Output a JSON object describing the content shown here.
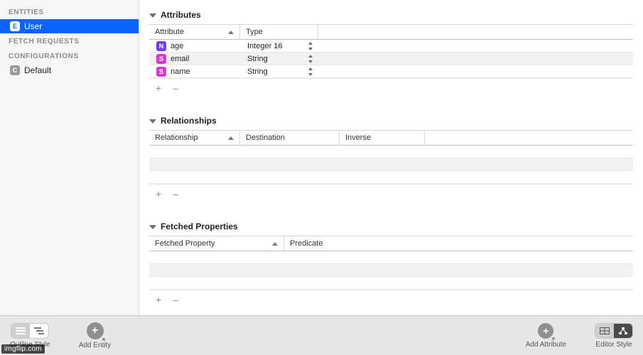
{
  "sidebar": {
    "sections": [
      {
        "title": "ENTITIES",
        "items": [
          {
            "badge": "E",
            "label": "User",
            "selected": true
          }
        ]
      },
      {
        "title": "FETCH REQUESTS",
        "items": []
      },
      {
        "title": "CONFIGURATIONS",
        "items": [
          {
            "badge": "C",
            "label": "Default",
            "selected": false
          }
        ]
      }
    ]
  },
  "attributes": {
    "title": "Attributes",
    "columns": {
      "attribute": "Attribute",
      "type": "Type"
    },
    "rows": [
      {
        "badge": "N",
        "name": "age",
        "type": "Integer 16"
      },
      {
        "badge": "S",
        "name": "email",
        "type": "String"
      },
      {
        "badge": "S",
        "name": "name",
        "type": "String"
      }
    ],
    "add_glyph": "+",
    "remove_glyph": "–"
  },
  "relationships": {
    "title": "Relationships",
    "columns": {
      "relationship": "Relationship",
      "destination": "Destination",
      "inverse": "Inverse"
    },
    "rows": [],
    "add_glyph": "+",
    "remove_glyph": "–"
  },
  "fetched_properties": {
    "title": "Fetched Properties",
    "columns": {
      "fetched_property": "Fetched Property",
      "predicate": "Predicate"
    },
    "rows": [],
    "add_glyph": "+",
    "remove_glyph": "–"
  },
  "toolbar": {
    "outline_style": "Outline Style",
    "add_entity": "Add Entity",
    "add_attribute": "Add Attribute",
    "editor_style": "Editor Style"
  },
  "watermark": "imgflip.com"
}
